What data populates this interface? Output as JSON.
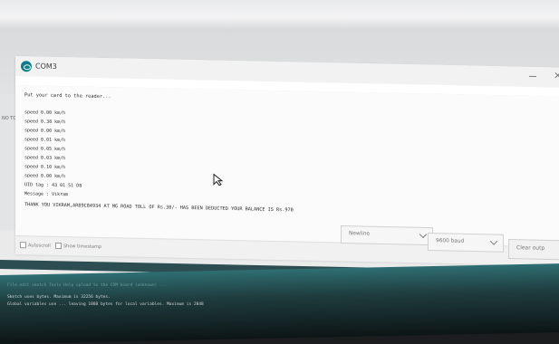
{
  "window": {
    "title": "COM3",
    "close_glyph": "×",
    "minimize_icon": "minimize-icon"
  },
  "serial_monitor": {
    "first_line": "Put your card to the reader...",
    "lines": [
      "speed 0.00 km/h",
      "speed 0.38 km/h",
      "speed 0.00 km/h",
      "speed 0.01 km/h",
      "speed 0.05 km/h",
      "speed 0.03 km/h",
      "speed 0.10 km/h",
      "speed 0.00 km/h",
      "UID tag : 43 01 51 D8",
      "Message : Vikram"
    ],
    "deduction_line": "THANK YOU VIKRAM,AR09C84934 AT  MG ROAD TOLL OF Rs.30/- HAS BEEN DEDUCTED YOUR BALANCE IS Rs.970"
  },
  "options": {
    "autoscroll_label": "Autoscroll",
    "timestamp_label": "Show timestamp"
  },
  "controls": {
    "line_ending": "Newline",
    "baud_rate": "9600 baud",
    "clear_output": "Clear outp"
  },
  "left_panel": {
    "snippet": "NO TO"
  },
  "ide_console": {
    "line1": "File edit sketch Tools Help  upload to the COM board (unknown) ...",
    "line2": "Sketch uses bytes. Maximum is 32256 bytes.",
    "line3": "Global variables use ... leaving 1088 bytes for local variables. Maximum is 2048",
    "line4": ""
  },
  "status_bar": {
    "text": ""
  },
  "colors": {
    "teal": "#0f7d86",
    "window_bg": "#f7f7f8",
    "text": "#2f2f2f"
  }
}
